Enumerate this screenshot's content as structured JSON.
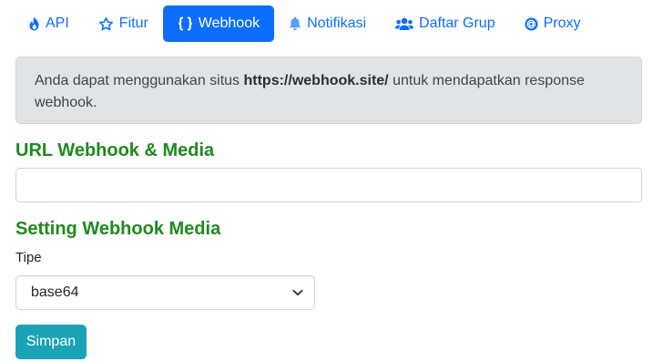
{
  "tabs": [
    {
      "label": "API",
      "icon": "fire-icon",
      "active": false
    },
    {
      "label": "Fitur",
      "icon": "star-icon",
      "active": false
    },
    {
      "label": "Webhook",
      "icon": "braces-icon",
      "active": true
    },
    {
      "label": "Notifikasi",
      "icon": "bell-icon",
      "active": false
    },
    {
      "label": "Daftar Grup",
      "icon": "users-icon",
      "active": false
    },
    {
      "label": "Proxy",
      "icon": "at-icon",
      "active": false
    }
  ],
  "alert": {
    "prefix": "Anda dapat menggunakan situs ",
    "link": "https://webhook.site/",
    "suffix": " untuk mendapatkan response webhook."
  },
  "url_section": {
    "title": "URL Webhook & Media",
    "input_value": ""
  },
  "media_section": {
    "title": "Setting Webhook Media",
    "type_label": "Tipe",
    "type_value": "base64"
  },
  "save_label": "Simpan",
  "colors": {
    "primary": "#0d6efd",
    "heading_green": "#1e8a1e",
    "alert_bg": "#e2e3e5",
    "save_button": "#1aa3b5"
  }
}
